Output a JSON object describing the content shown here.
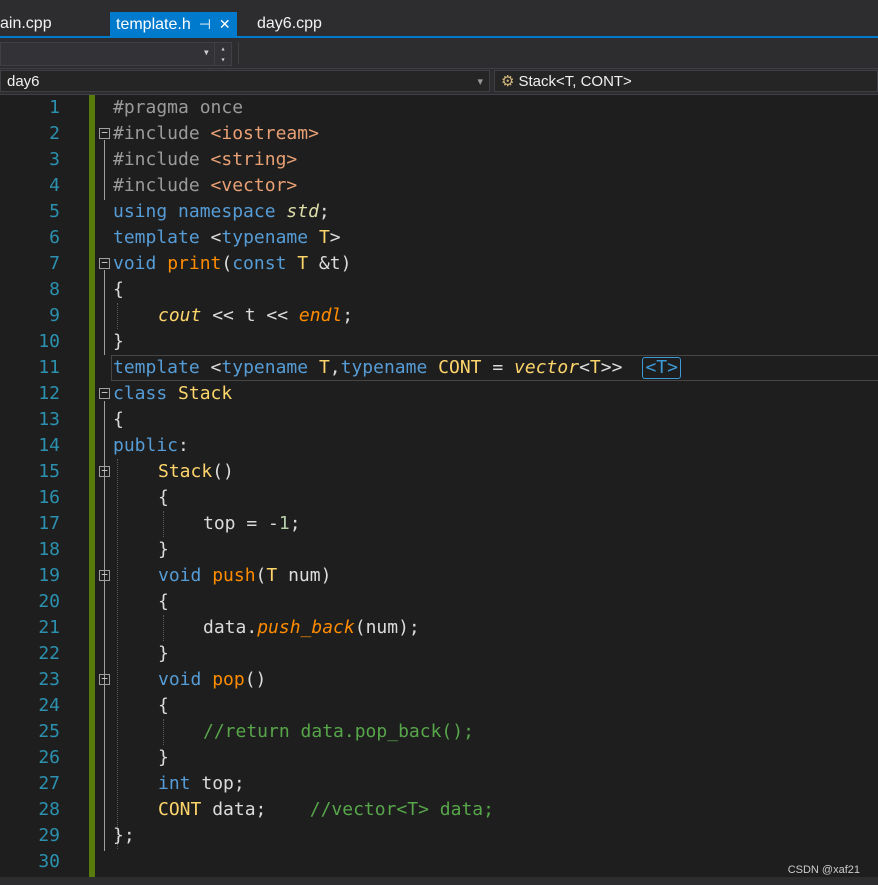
{
  "tabs": [
    {
      "label": "ain.cpp"
    },
    {
      "label": "template.h",
      "pin": "⊣",
      "close": "✕"
    },
    {
      "label": "day6.cpp"
    }
  ],
  "nav": {
    "project": "day6",
    "scope": "Stack<T, CONT>"
  },
  "watermark": "CSDN @xaf21",
  "hint": "<T>",
  "line_numbers": [
    "1",
    "2",
    "3",
    "4",
    "5",
    "6",
    "7",
    "8",
    "9",
    "10",
    "11",
    "12",
    "13",
    "14",
    "15",
    "16",
    "17",
    "18",
    "19",
    "20",
    "21",
    "22",
    "23",
    "24",
    "25",
    "26",
    "27",
    "28",
    "29",
    "30"
  ],
  "code": {
    "l1": {
      "a": "#pragma once"
    },
    "l2": {
      "a": "#include ",
      "b": "<iostream>"
    },
    "l3": {
      "a": "#include ",
      "b": "<string>"
    },
    "l4": {
      "a": "#include ",
      "b": "<vector>"
    },
    "l5": {
      "a": "using namespace ",
      "b": "std",
      "c": ";"
    },
    "l6": {
      "a": "template ",
      "b": "<",
      "c": "typename ",
      "d": "T",
      "e": ">"
    },
    "l7": {
      "a": "void ",
      "b": "print",
      "c": "(",
      "d": "const ",
      "e": "T",
      "f": " &t)"
    },
    "l8": {
      "a": "{"
    },
    "l9": {
      "a": "cout",
      "b": " << t << ",
      "c": "endl",
      "d": ";"
    },
    "l10": {
      "a": "}"
    },
    "l11": {
      "a": "template ",
      "b": "<",
      "c": "typename ",
      "d": "T",
      "e": ",",
      "f": "typename ",
      "g": "CONT",
      "h": " = ",
      "i": "vector",
      "j": "<",
      "k": "T",
      "l": ">>"
    },
    "l12": {
      "a": "class ",
      "b": "Stack"
    },
    "l13": {
      "a": "{"
    },
    "l14": {
      "a": "public",
      "b": ":"
    },
    "l15": {
      "a": "Stack",
      "b": "()"
    },
    "l16": {
      "a": "{"
    },
    "l17": {
      "a": "top",
      "b": " = -",
      "c": "1",
      "d": ";"
    },
    "l18": {
      "a": "}"
    },
    "l19": {
      "a": "void ",
      "b": "push",
      "c": "(",
      "d": "T",
      "e": " num)"
    },
    "l20": {
      "a": "{"
    },
    "l21": {
      "a": "data.",
      "b": "push_back",
      "c": "(num);"
    },
    "l22": {
      "a": "}"
    },
    "l23": {
      "a": "void ",
      "b": "pop",
      "c": "()"
    },
    "l24": {
      "a": "{"
    },
    "l25": {
      "a": "//return data.pop_back();"
    },
    "l26": {
      "a": "}"
    },
    "l27": {
      "a": "int ",
      "b": "top",
      "c": ";"
    },
    "l28": {
      "a": "CONT",
      "b": " data;    ",
      "c": "//vector<T> data;"
    },
    "l29": {
      "a": "};"
    },
    "l30": {
      "a": ""
    }
  }
}
